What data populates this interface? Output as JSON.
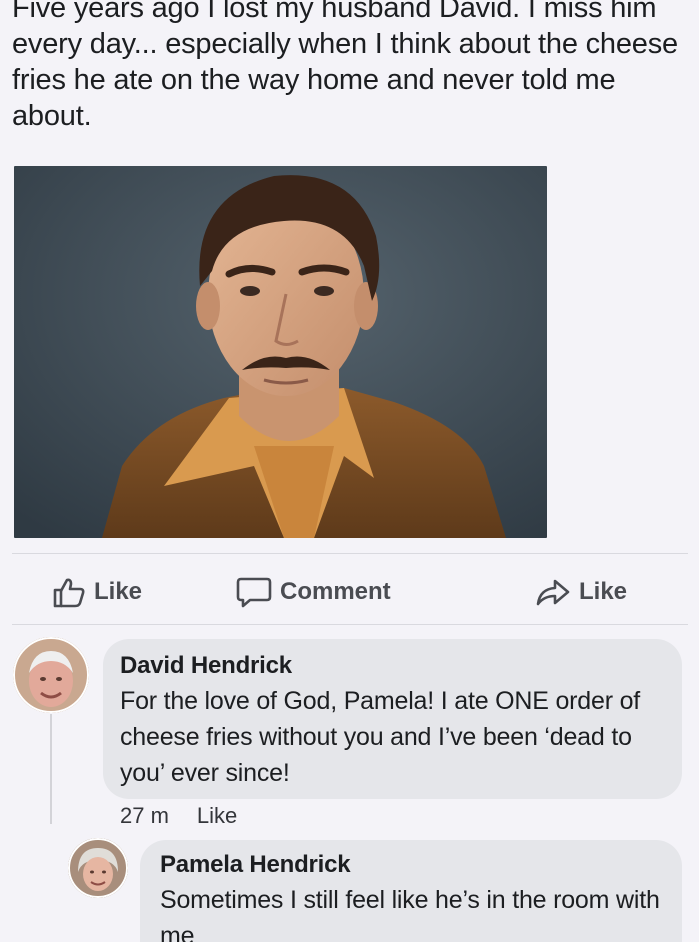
{
  "post": {
    "text": "Five years ago I lost my husband David. I miss him every day... especially when I think about the cheese fries he ate on the way home and never told me about."
  },
  "actions": {
    "like_label": "Like",
    "comment_label": "Comment",
    "share_label": "Like"
  },
  "comments": [
    {
      "author": "David Hendrick",
      "text": "For the love of God, Pamela! I ate ONE order of cheese fries without you and I’ve been ‘dead to you’ ever since!",
      "time": "27 m",
      "like_label": "Like"
    },
    {
      "author": "Pamela Hendrick",
      "text": "Sometimes I still feel like he’s in the room with me"
    }
  ],
  "icons": {
    "like": "thumbs-up-icon",
    "comment": "speech-bubble-icon",
    "share": "share-arrow-icon"
  },
  "colors": {
    "background": "#f4f3f8",
    "bubble": "#e5e6ea",
    "action_text": "#4a4c52"
  }
}
